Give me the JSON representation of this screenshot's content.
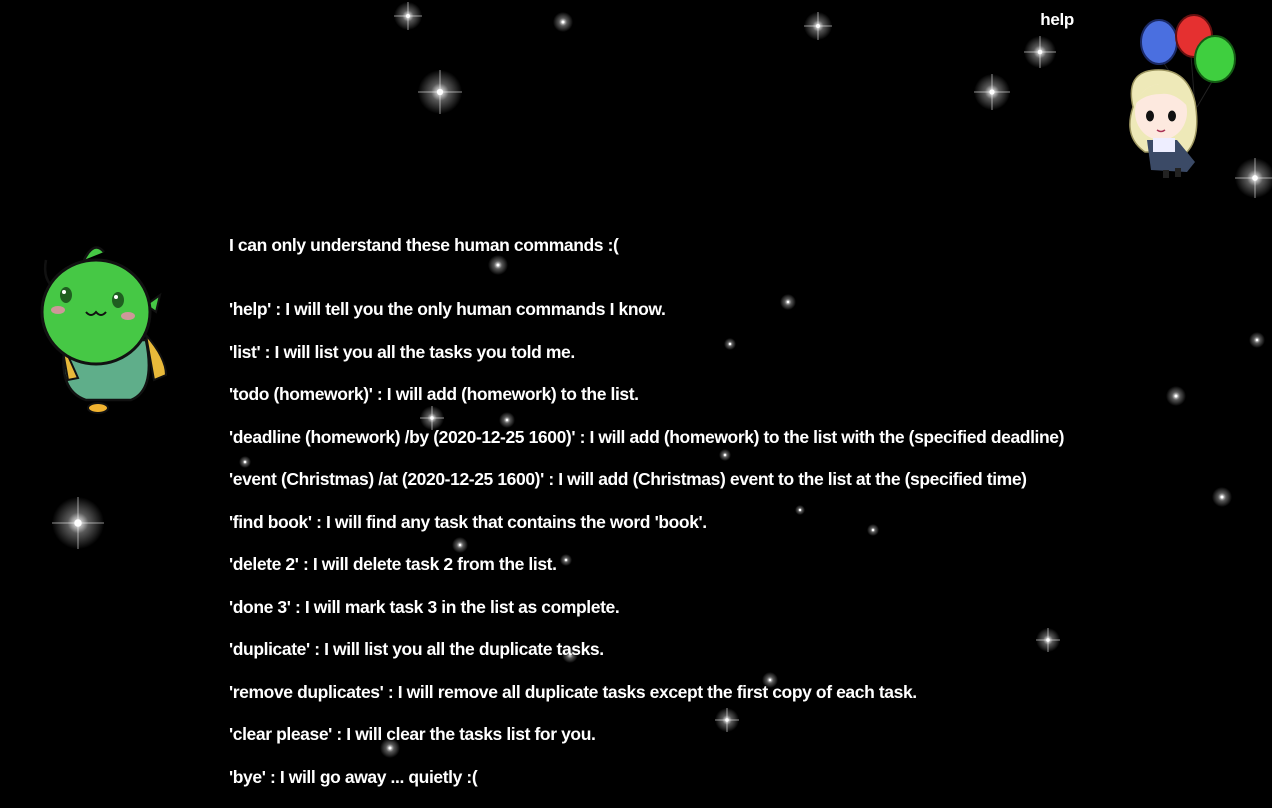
{
  "user_message": {
    "text": "help"
  },
  "bot_reply": {
    "intro": "I can only understand these human commands :(",
    "commands": [
      "'help' : I will tell you the only human commands I know.",
      "'list' : I will list you all the tasks you told me.",
      "'todo (homework)' : I will add (homework) to the list.",
      "'deadline (homework) /by (2020-12-25 1600)' : I will add (homework) to the list with the (specified deadline)",
      "'event (Christmas) /at (2020-12-25 1600)' : I will add (Christmas) event to the list at the (specified time)",
      "'find book' : I will find any task that contains the word 'book'.",
      "'delete 2' : I will delete task 2 from the list.",
      "'done 3' : I will mark task 3 in the list as complete.",
      "'duplicate' : I will list you all the duplicate tasks.",
      "'remove duplicates' : I will remove all duplicate tasks except the first copy of each task.",
      "'clear please' : I will clear the tasks list for you.",
      "'bye' : I will go away ... quietly :("
    ]
  },
  "avatars": {
    "user": {
      "icon": "girl-with-balloons-avatar-icon",
      "balloon_colors": [
        "#4a6fe0",
        "#e53030",
        "#3fcf3f"
      ],
      "hair_color": "#eee9b8"
    },
    "bot": {
      "icon": "green-alien-avatar-icon",
      "body_color": "#46c845",
      "robe_color": "#5fae8a"
    }
  },
  "colors": {
    "background": "#000000",
    "text": "#ffffff"
  }
}
